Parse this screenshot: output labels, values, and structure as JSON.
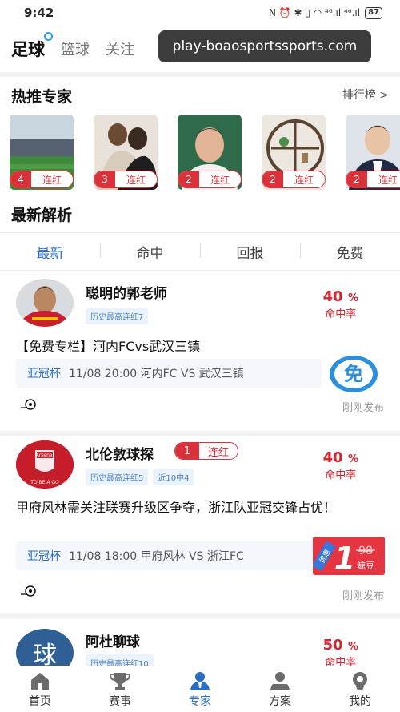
{
  "status_bar": {
    "time": "9:42",
    "icons_text": "N ⏰ ✱ ▯ ◠ ⁴⁶.ıl ⁴⁶.ıl",
    "battery": "87"
  },
  "top_tabs": [
    {
      "label": "足球"
    },
    {
      "label": "篮球"
    },
    {
      "label": "关注"
    }
  ],
  "url_overlay": "play-boaosportssports.com",
  "hot_experts": {
    "title": "热推专家",
    "rank_link": "排行榜 >",
    "items": [
      {
        "streak": "4",
        "label": "连红"
      },
      {
        "streak": "3",
        "label": "连红"
      },
      {
        "streak": "2",
        "label": "连红"
      },
      {
        "streak": "2",
        "label": "连红"
      },
      {
        "streak": "2",
        "label": "连红"
      }
    ]
  },
  "latest": {
    "title": "最新解析",
    "filters": [
      {
        "label": "最新"
      },
      {
        "label": "命中"
      },
      {
        "label": "回报"
      },
      {
        "label": "免费"
      }
    ]
  },
  "cards": [
    {
      "name": "聪明的郭老师",
      "tags": [
        "历史最高连红7"
      ],
      "rate": "40",
      "rate_unit": "%",
      "rate_caption": "命中率",
      "title": "【免费专栏】河内FCvs武汉三镇",
      "league": "亚冠杯",
      "match_info": "11/08 20:00 河内FC VS 武汉三镇",
      "badge": "免",
      "ago": "刚刚发布"
    },
    {
      "name": "北伦敦球探",
      "streak_num": "1",
      "streak_label": "连红",
      "tags": [
        "历史最高连红5",
        "近10中4"
      ],
      "rate": "40",
      "rate_unit": "%",
      "rate_caption": "命中率",
      "avatar_text": "Arsenal",
      "avatar_sub": "TO BE A GO",
      "title": "甲府风林需关注联赛升级区争夺，浙江队亚冠交锋占优！",
      "league": "亚冠杯",
      "match_info": "11/08 18:00 甲府风林 VS 浙江FC",
      "price_tag": "优惠",
      "price_new": "1",
      "price_old": "98",
      "price_unit": "鲸豆",
      "ago": "刚刚发布"
    },
    {
      "name": "阿杜聊球",
      "avatar_text": "球",
      "tags": [
        "历史最高连红10"
      ],
      "rate": "50",
      "rate_unit": "%",
      "rate_caption": "命中率"
    }
  ],
  "bottom_nav": [
    {
      "label": "首页",
      "icon": "home-icon"
    },
    {
      "label": "赛事",
      "icon": "trophy-icon"
    },
    {
      "label": "专家",
      "icon": "expert-icon"
    },
    {
      "label": "方案",
      "icon": "plan-icon"
    },
    {
      "label": "我的",
      "icon": "profile-icon"
    }
  ],
  "colors": {
    "accent": "#2b6cc4",
    "red": "#d9232e"
  }
}
